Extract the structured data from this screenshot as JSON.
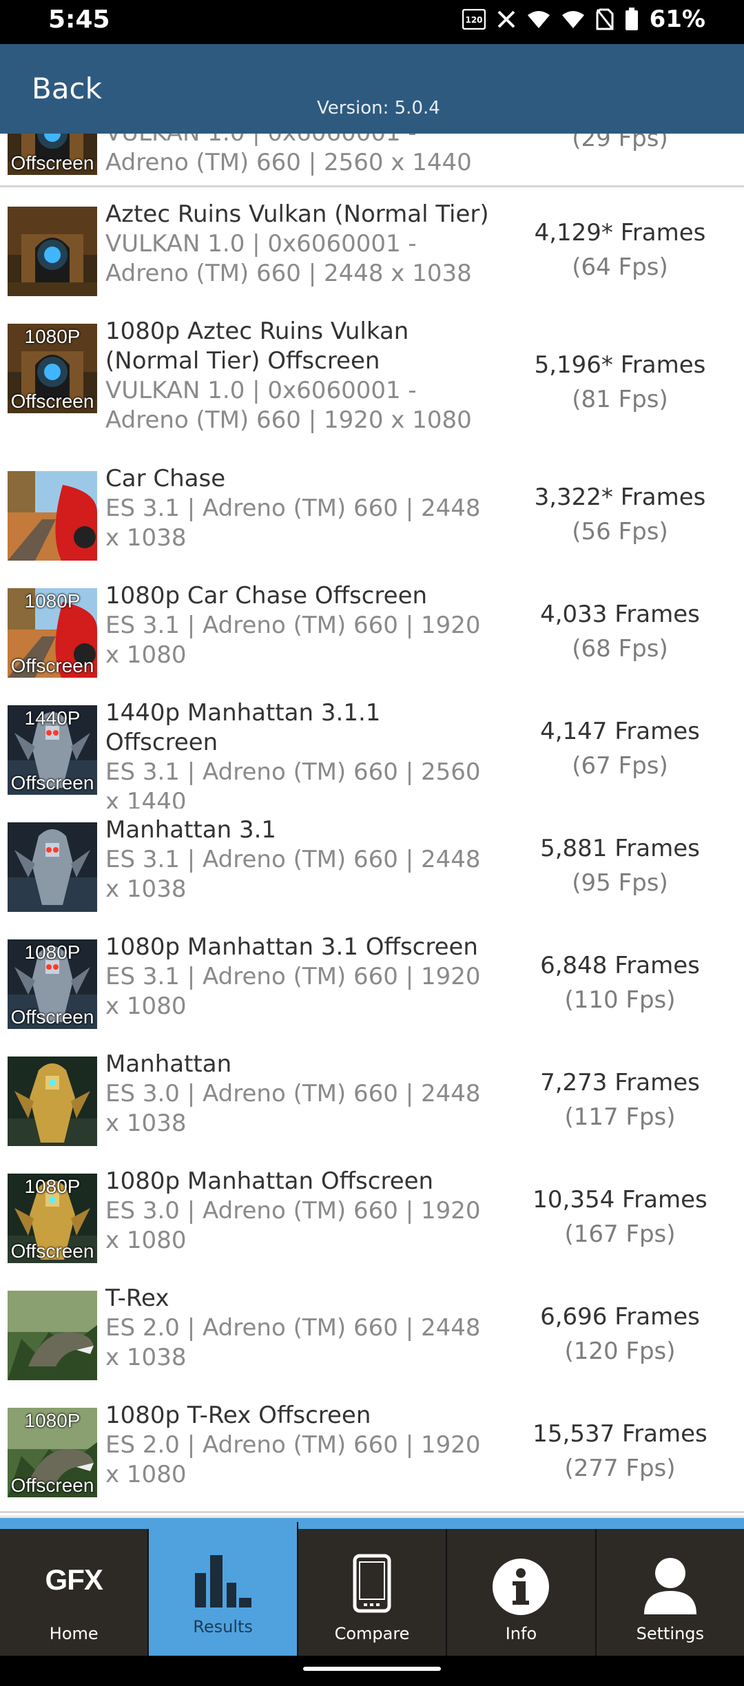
{
  "status_bar": {
    "time": "5:45",
    "battery": "61%",
    "refresh_rate": "120 Hz",
    "icons": [
      "hz-icon",
      "x-app-icon",
      "wifi-icon",
      "signal-icon",
      "no-sim-icon",
      "battery-icon"
    ]
  },
  "header": {
    "back_label": "Back",
    "version": "Version: 5.0.4",
    "bg_color": "#2e5a7f"
  },
  "results": [
    {
      "title": "",
      "subtitle": "VULKAN 1.0 | 0x6060001 - Adreno (TM) 660 | 2560 x 1440",
      "frames": "",
      "fps": "(29 Fps)",
      "thumb_badge_top": "",
      "thumb_badge_bottom": "Offscreen",
      "thumb": "aztec"
    },
    {
      "title": "Aztec Ruins Vulkan (Normal Tier)",
      "subtitle": "VULKAN 1.0 | 0x6060001 - Adreno (TM) 660 | 2448 x 1038",
      "frames": "4,129* Frames",
      "fps": "(64 Fps)",
      "thumb_badge_top": "",
      "thumb_badge_bottom": "",
      "thumb": "aztec"
    },
    {
      "title": "1080p Aztec Ruins Vulkan (Normal Tier) Offscreen",
      "subtitle": "VULKAN 1.0 | 0x6060001 - Adreno (TM) 660 | 1920 x 1080",
      "frames": "5,196* Frames",
      "fps": "(81 Fps)",
      "thumb_badge_top": "1080P",
      "thumb_badge_bottom": "Offscreen",
      "thumb": "aztec"
    },
    {
      "title": "Car Chase",
      "subtitle": "ES 3.1 | Adreno (TM) 660 | 2448 x 1038",
      "frames": "3,322* Frames",
      "fps": "(56 Fps)",
      "thumb_badge_top": "",
      "thumb_badge_bottom": "",
      "thumb": "car"
    },
    {
      "title": "1080p Car Chase Offscreen",
      "subtitle": "ES 3.1 | Adreno (TM) 660 | 1920 x 1080",
      "frames": "4,033 Frames",
      "fps": "(68 Fps)",
      "thumb_badge_top": "1080P",
      "thumb_badge_bottom": "Offscreen",
      "thumb": "car"
    },
    {
      "title": "1440p Manhattan 3.1.1 Offscreen",
      "subtitle": "ES 3.1 | Adreno (TM) 660 | 2560 x 1440",
      "frames": "4,147 Frames",
      "fps": "(67 Fps)",
      "thumb_badge_top": "1440P",
      "thumb_badge_bottom": "Offscreen",
      "thumb": "robot"
    },
    {
      "title": "Manhattan 3.1",
      "subtitle": "ES 3.1 | Adreno (TM) 660 | 2448 x 1038",
      "frames": "5,881 Frames",
      "fps": "(95 Fps)",
      "thumb_badge_top": "",
      "thumb_badge_bottom": "",
      "thumb": "robot"
    },
    {
      "title": "1080p Manhattan 3.1 Offscreen",
      "subtitle": "ES 3.1 | Adreno (TM) 660 | 1920 x 1080",
      "frames": "6,848 Frames",
      "fps": "(110 Fps)",
      "thumb_badge_top": "1080P",
      "thumb_badge_bottom": "Offscreen",
      "thumb": "robot"
    },
    {
      "title": "Manhattan",
      "subtitle": "ES 3.0 | Adreno (TM) 660 | 2448 x 1038",
      "frames": "7,273 Frames",
      "fps": "(117 Fps)",
      "thumb_badge_top": "",
      "thumb_badge_bottom": "",
      "thumb": "gold"
    },
    {
      "title": "1080p Manhattan Offscreen",
      "subtitle": "ES 3.0 | Adreno (TM) 660 | 1920 x 1080",
      "frames": "10,354 Frames",
      "fps": "(167 Fps)",
      "thumb_badge_top": "1080P",
      "thumb_badge_bottom": "Offscreen",
      "thumb": "gold"
    },
    {
      "title": "T-Rex",
      "subtitle": "ES 2.0 | Adreno (TM) 660 | 2448 x 1038",
      "frames": "6,696 Frames",
      "fps": "(120 Fps)",
      "thumb_badge_top": "",
      "thumb_badge_bottom": "",
      "thumb": "trex"
    },
    {
      "title": "1080p T-Rex Offscreen",
      "subtitle": "ES 2.0 | Adreno (TM) 660 | 1920 x 1080",
      "frames": "15,537 Frames",
      "fps": "(277 Fps)",
      "thumb_badge_top": "1080P",
      "thumb_badge_bottom": "Offscreen",
      "thumb": "trex"
    }
  ],
  "bottom_nav": {
    "active": "Results",
    "accent_color": "#4fa2de",
    "items": [
      {
        "label": "Home",
        "logo_text": "GFX",
        "icon": "gfx-logo"
      },
      {
        "label": "Results",
        "icon": "bar-chart-icon"
      },
      {
        "label": "Compare",
        "icon": "phone-icon"
      },
      {
        "label": "Info",
        "icon": "info-icon"
      },
      {
        "label": "Settings",
        "icon": "user-icon"
      }
    ]
  }
}
